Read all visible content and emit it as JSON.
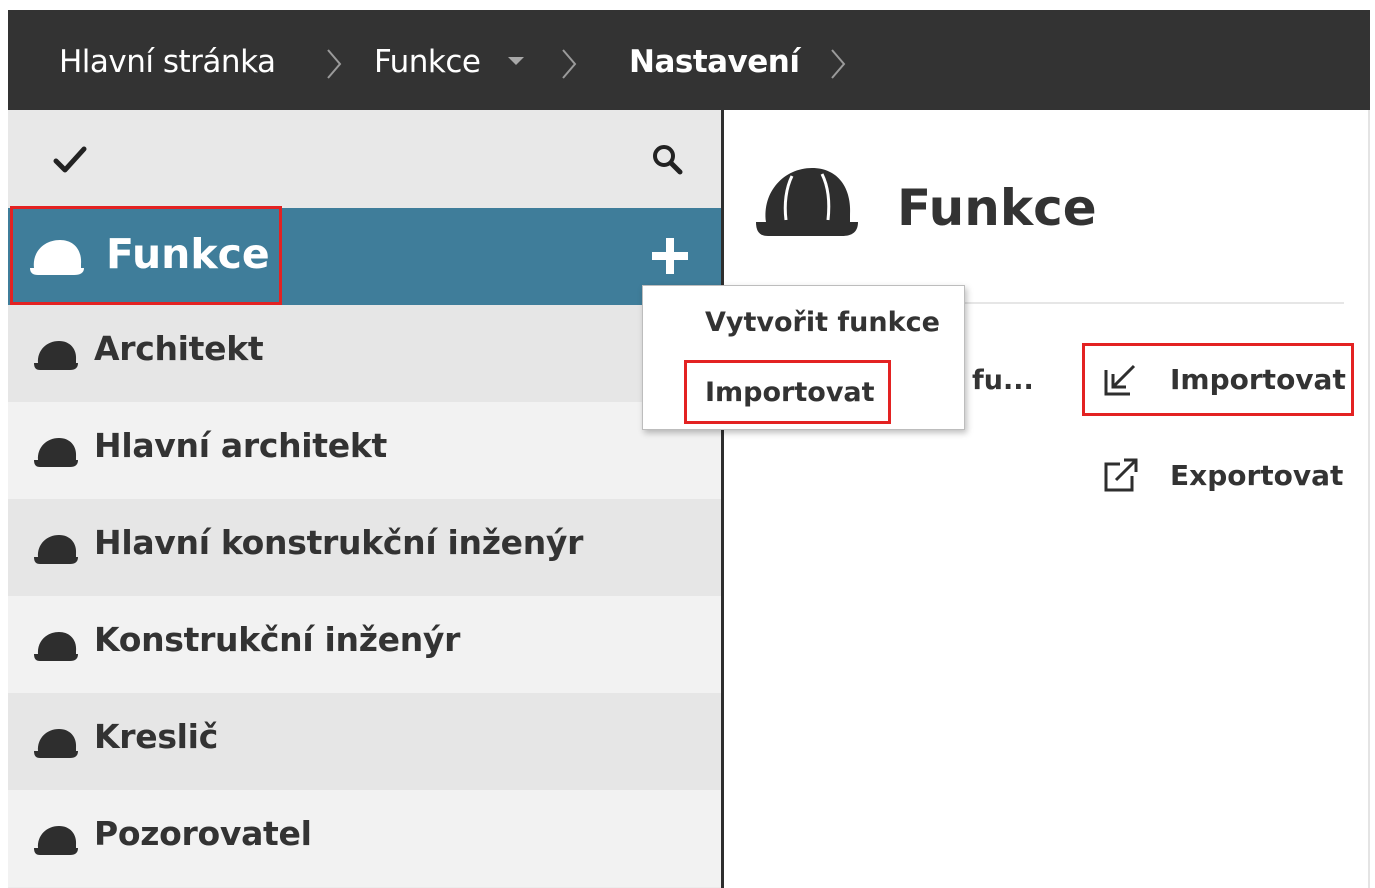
{
  "breadcrumb": {
    "items": [
      {
        "label": "Hlavní stránka"
      },
      {
        "label": "Funkce"
      },
      {
        "label": "Nastavení"
      }
    ]
  },
  "sidebar": {
    "selected": {
      "label": "Funkce"
    },
    "items": [
      {
        "label": "Architekt"
      },
      {
        "label": "Hlavní architekt"
      },
      {
        "label": "Hlavní konstrukční inženýr"
      },
      {
        "label": "Konstrukční inženýr"
      },
      {
        "label": "Kreslič"
      },
      {
        "label": "Pozorovatel"
      }
    ]
  },
  "dropdown": {
    "items": [
      {
        "label": "Vytvořit funkce"
      },
      {
        "label": "Importovat"
      }
    ]
  },
  "main": {
    "title": "Funkce",
    "truncated_text": "fu...",
    "actions": [
      {
        "label": "Importovat",
        "icon": "import-icon"
      },
      {
        "label": "Exportovat",
        "icon": "export-icon"
      }
    ]
  },
  "colors": {
    "topbar": "#333333",
    "selected_row": "#3f7d9a",
    "highlight": "#e32222"
  }
}
